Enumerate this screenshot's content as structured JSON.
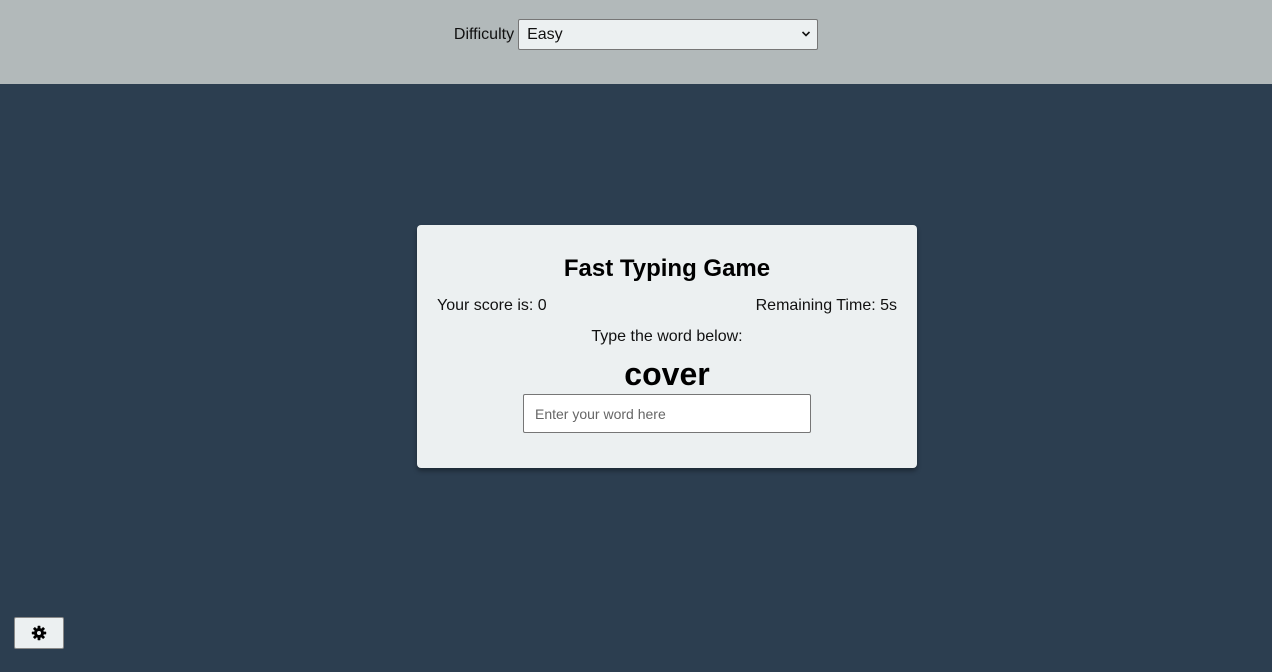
{
  "settings": {
    "difficulty_label": "Difficulty",
    "difficulty_selected": "Easy",
    "difficulty_options": [
      "Easy"
    ]
  },
  "game": {
    "title": "Fast Typing Game",
    "score_text": "Your score is: 0",
    "time_text": "Remaining Time: 5s",
    "prompt": "Type the word below:",
    "word": "cover",
    "input_value": "",
    "input_placeholder": "Enter your word here"
  },
  "settings_button": {
    "icon": "gear-icon"
  },
  "colors": {
    "background": "#2c3e50",
    "settings_bar": "#b2b9ba",
    "card": "#ecf0f1"
  }
}
